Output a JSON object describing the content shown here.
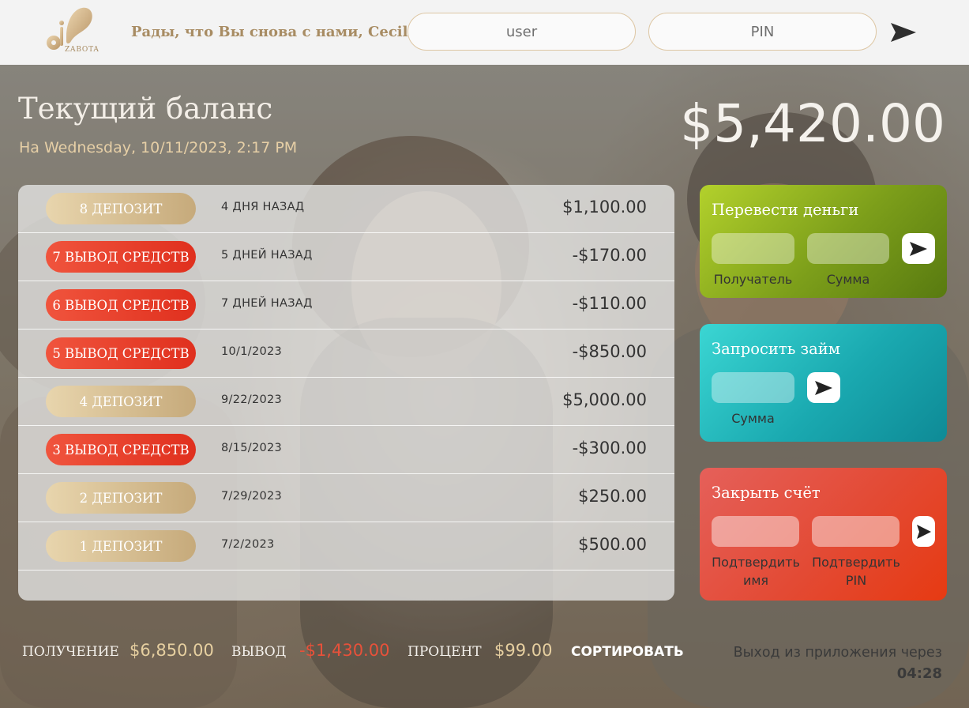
{
  "nav": {
    "logo_text": "ZABOTA",
    "welcome": "Рады, что Вы снова с нами, Cecil",
    "user_placeholder": "user",
    "pin_placeholder": "PIN"
  },
  "balance": {
    "title": "Текущий баланс",
    "date": "На Wednesday, 10/11/2023, 2:17 PM",
    "value": "$5,420.00"
  },
  "movements": [
    {
      "type": "deposit",
      "label": "8 ДЕПОЗИТ",
      "date": "4 ДНЯ НАЗАД",
      "value": "$1,100.00"
    },
    {
      "type": "withdrawal",
      "label": "7 ВЫВОД СРЕДСТВ",
      "date": "5 ДНЕЙ НАЗАД",
      "value": "-$170.00"
    },
    {
      "type": "withdrawal",
      "label": "6 ВЫВОД СРЕДСТВ",
      "date": "7 ДНЕЙ НАЗАД",
      "value": "-$110.00"
    },
    {
      "type": "withdrawal",
      "label": "5 ВЫВОД СРЕДСТВ",
      "date": "10/1/2023",
      "value": "-$850.00"
    },
    {
      "type": "deposit",
      "label": "4 ДЕПОЗИТ",
      "date": "9/22/2023",
      "value": "$5,000.00"
    },
    {
      "type": "withdrawal",
      "label": "3 ВЫВОД СРЕДСТВ",
      "date": "8/15/2023",
      "value": "-$300.00"
    },
    {
      "type": "deposit",
      "label": "2 ДЕПОЗИТ",
      "date": "7/29/2023",
      "value": "$250.00"
    },
    {
      "type": "deposit",
      "label": "1 ДЕПОЗИТ",
      "date": "7/2/2023",
      "value": "$500.00"
    }
  ],
  "operations": {
    "transfer": {
      "title": "Перевести деньги",
      "label_to": "Получатель",
      "label_amount": "Сумма"
    },
    "loan": {
      "title": "Запросить займ",
      "label_amount": "Сумма"
    },
    "close": {
      "title": "Закрыть счёт",
      "label_user": "Подтвердить имя",
      "label_pin": "Подтвердить PIN"
    }
  },
  "summary": {
    "in_label": "ПОЛУЧЕНИЕ",
    "in_value": "$6,850.00",
    "out_label": "ВЫВОД",
    "out_value": "-$1,430.00",
    "interest_label": "ПРОЦЕНТ",
    "interest_value": "$99.00",
    "sort_label": "СОРТИРОВАТЬ"
  },
  "logout": {
    "text": "Выход из приложения через",
    "timer": "04:28"
  },
  "colors": {
    "gold": "#c6aa7b",
    "withdrawal_red": "#e0301e",
    "transfer_green": "#7c9e1a",
    "loan_teal": "#1aa9b0",
    "close_red": "#e34a34"
  }
}
